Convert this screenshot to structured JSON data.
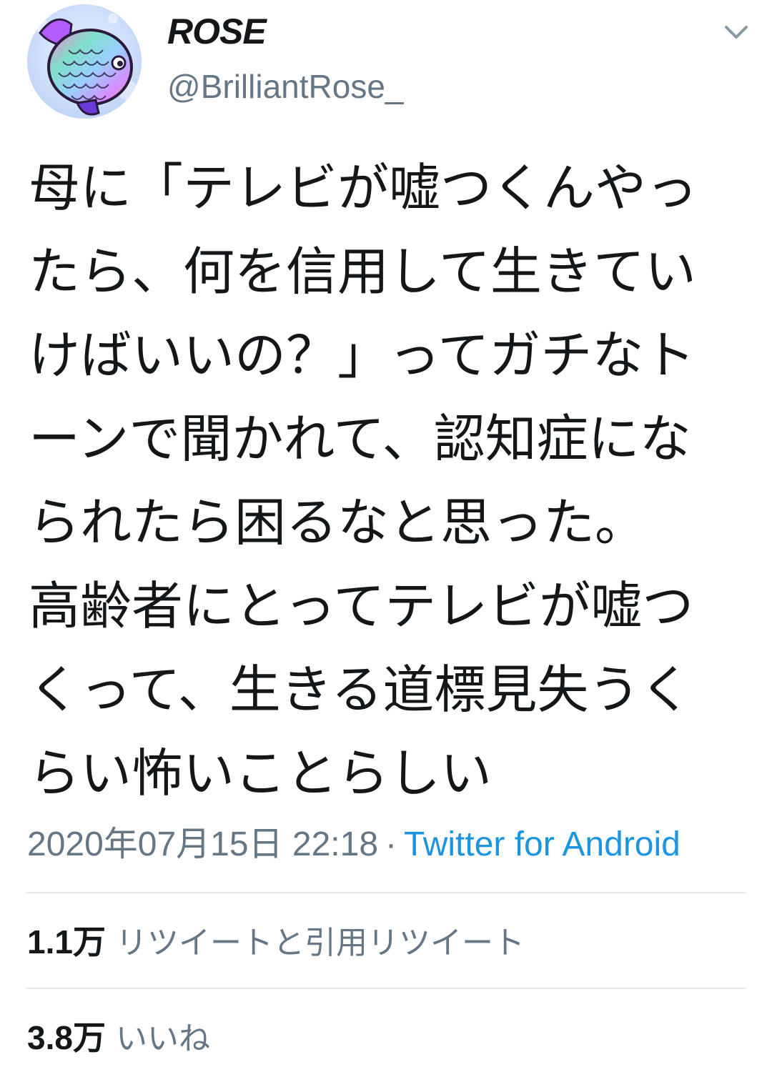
{
  "user": {
    "display_name": "ROSE",
    "handle": "@BrilliantRose_",
    "avatar_icon": "rainbow-fish-avatar"
  },
  "menu": {
    "caret_icon": "chevron-down-icon"
  },
  "tweet": {
    "lines": [
      "母に「テレビが嘘つくんやっ",
      "たら、何を信用して生きてい",
      "けばいいの？」ってガチなト",
      "ーンで聞かれて、認知症にな",
      "られたら困るなと思った。",
      "高齢者にとってテレビが嘘つ",
      "くって、生きる道標見失うく",
      "らい怖いことらしい"
    ],
    "timestamp": "2020年07月15日 22:18",
    "separator": "·",
    "source": "Twitter for Android"
  },
  "stats": {
    "retweets": {
      "count": "1.1万",
      "label": "リツイートと引用リツイート"
    },
    "likes": {
      "count": "3.8万",
      "label": "いいね"
    }
  },
  "colors": {
    "text": "#14171a",
    "secondary": "#657786",
    "link": "#1b95e0",
    "divider": "#e6ecf0"
  }
}
